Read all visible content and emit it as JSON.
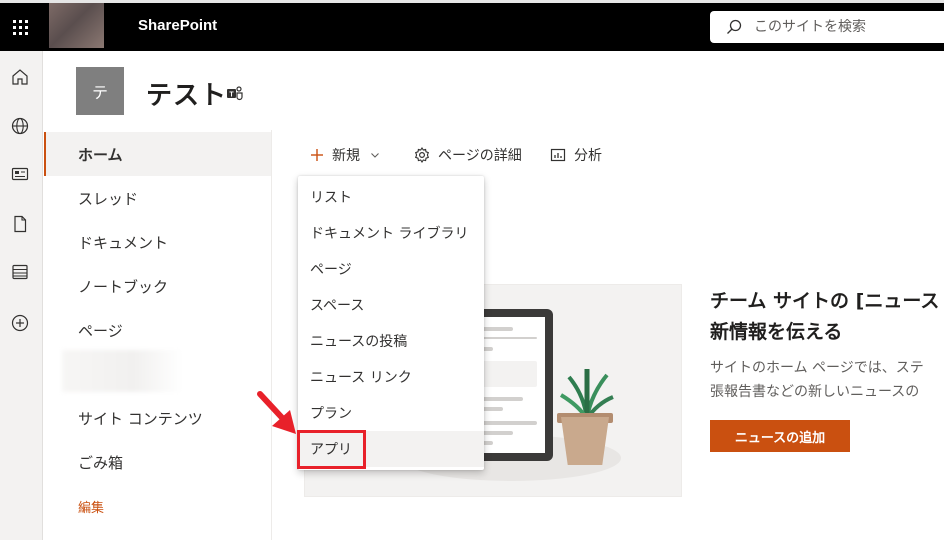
{
  "suite_bar": {
    "brand": "SharePoint",
    "search_placeholder": "このサイトを検索"
  },
  "site": {
    "logo_letter": "テ",
    "title": "テスト"
  },
  "left_nav": {
    "items": [
      {
        "label": "ホーム",
        "selected": true
      },
      {
        "label": "スレッド"
      },
      {
        "label": "ドキュメント"
      },
      {
        "label": "ノートブック"
      },
      {
        "label": "ページ"
      },
      {
        "label": "サイト コンテンツ"
      },
      {
        "label": "ごみ箱"
      }
    ],
    "edit_label": "編集"
  },
  "command_bar": {
    "new_label": "新規",
    "page_details_label": "ページの詳細",
    "analytics_label": "分析"
  },
  "new_menu": {
    "items": [
      "リスト",
      "ドキュメント ライブラリ",
      "ページ",
      "スペース",
      "ニュースの投稿",
      "ニュース リンク",
      "プラン",
      "アプリ"
    ]
  },
  "hero": {
    "title_line1": "チーム サイトの [ニュース",
    "title_line2": "新情報を伝える",
    "desc_line1": "サイトのホーム ページでは、ステ",
    "desc_line2": "張報告書などの新しいニュースの",
    "button_label": "ニュースの追加"
  },
  "colors": {
    "accent": "#ca5010",
    "suite_bar": "#000000",
    "highlight": "#e8212a"
  }
}
